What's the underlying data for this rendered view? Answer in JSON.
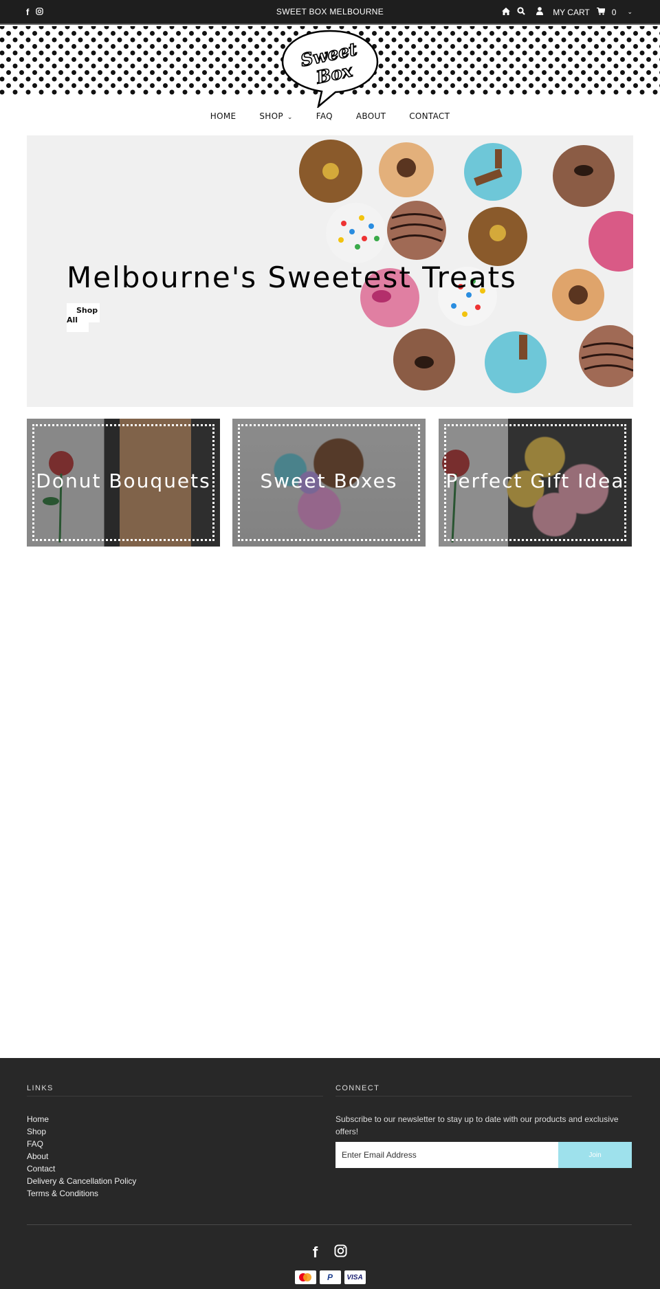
{
  "topbar": {
    "social": [
      {
        "icon": "facebook-icon",
        "glyph": "f"
      },
      {
        "icon": "instagram-icon",
        "glyph": "◎"
      }
    ],
    "brand": "SWEET BOX MELBOURNE",
    "cart_label": "MY CART",
    "cart_count": "0"
  },
  "logo": {
    "line1": "Sweet",
    "line2": "Box"
  },
  "nav": {
    "items": [
      {
        "label": "HOME",
        "has_dropdown": false
      },
      {
        "label": "SHOP",
        "has_dropdown": true
      },
      {
        "label": "FAQ",
        "has_dropdown": false
      },
      {
        "label": "ABOUT",
        "has_dropdown": false
      },
      {
        "label": "CONTACT",
        "has_dropdown": false
      }
    ]
  },
  "hero": {
    "title": "Melbourne's Sweetest Treats",
    "button_line1": "Shop",
    "button_line2": "All"
  },
  "tiles": [
    {
      "label": "Donut Bouquets"
    },
    {
      "label": "Sweet Boxes"
    },
    {
      "label": "Perfect Gift Idea"
    }
  ],
  "footer": {
    "links_heading": "LINKS",
    "links": [
      "Home",
      "Shop",
      "FAQ",
      "About",
      "Contact",
      "Delivery & Cancellation Policy",
      "Terms & Conditions"
    ],
    "connect_heading": "CONNECT",
    "newsletter_text": "Subscribe to our newsletter to stay up to date with our products and exclusive offers!",
    "email_placeholder": "Enter Email Address",
    "join_label": "Join",
    "payments": [
      "mastercard",
      "paypal",
      "VISA"
    ]
  },
  "colors": {
    "topbar_bg": "#1e1e1e",
    "footer_bg": "#282828",
    "join_button": "#9ee1ec",
    "hero_bg": "#f0f0f0"
  }
}
